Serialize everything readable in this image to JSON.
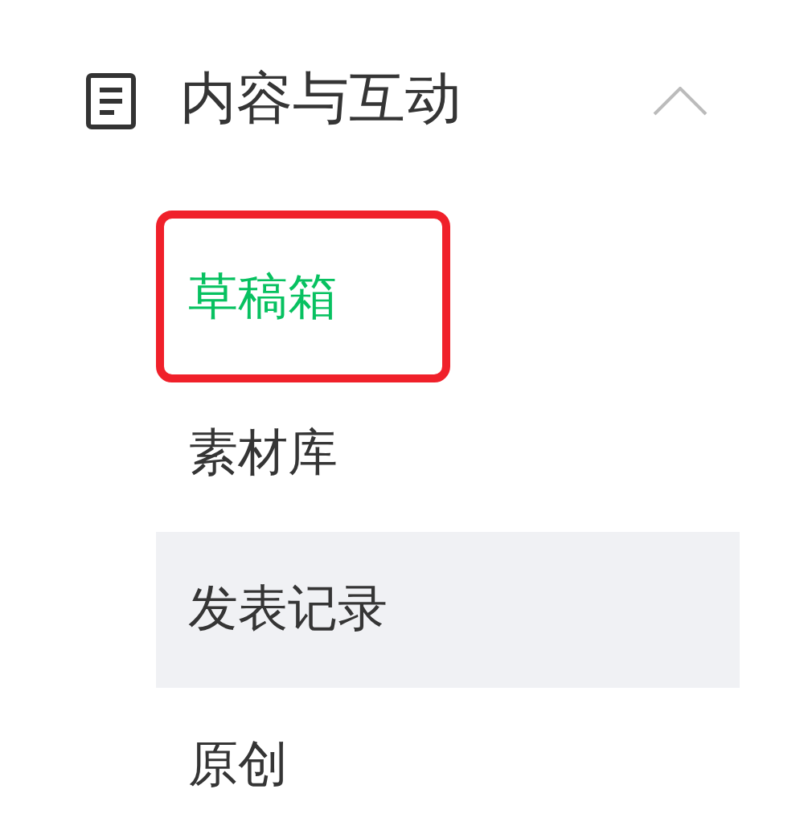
{
  "section": {
    "title": "内容与互动",
    "expanded": true
  },
  "items": [
    {
      "label": "草稿箱",
      "selected": true,
      "hovered": false,
      "annotated": true
    },
    {
      "label": "素材库",
      "selected": false,
      "hovered": false,
      "annotated": false
    },
    {
      "label": "发表记录",
      "selected": false,
      "hovered": true,
      "annotated": false
    },
    {
      "label": "原创",
      "selected": false,
      "hovered": false,
      "annotated": false
    }
  ]
}
